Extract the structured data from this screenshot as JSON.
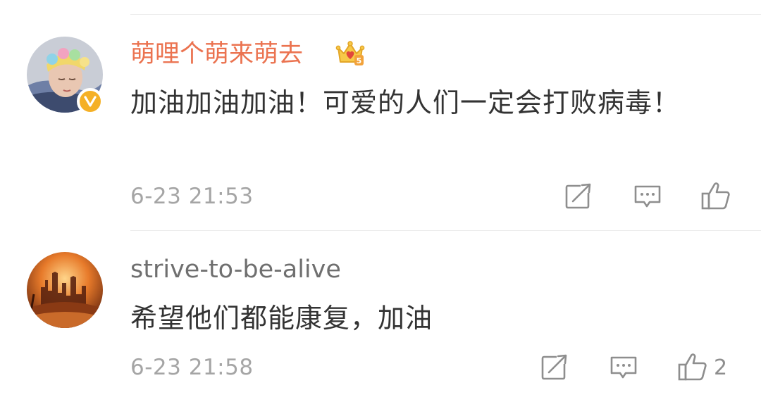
{
  "comments": [
    {
      "username": "萌哩个萌来萌去",
      "text": "加油加油加油！可爱的人们一定会打败病毒！",
      "time": "6-23 21:53",
      "verified": true,
      "crown_badge_level": "5",
      "like_count": ""
    },
    {
      "username": "strive-to-be-alive",
      "text": "希望他们都能康复，加油",
      "time": "6-23 21:58",
      "verified": false,
      "like_count": "2"
    }
  ],
  "icons": {
    "repost": "repost-icon",
    "comment": "comment-icon",
    "like": "like-icon",
    "verified": "verified-v-icon",
    "crown": "crown-badge-icon"
  },
  "colors": {
    "vip_name": "#eb7350",
    "name": "#6f6f6f",
    "text": "#333333",
    "time": "#a5a5a5",
    "verified_badge": "#f5b026"
  }
}
